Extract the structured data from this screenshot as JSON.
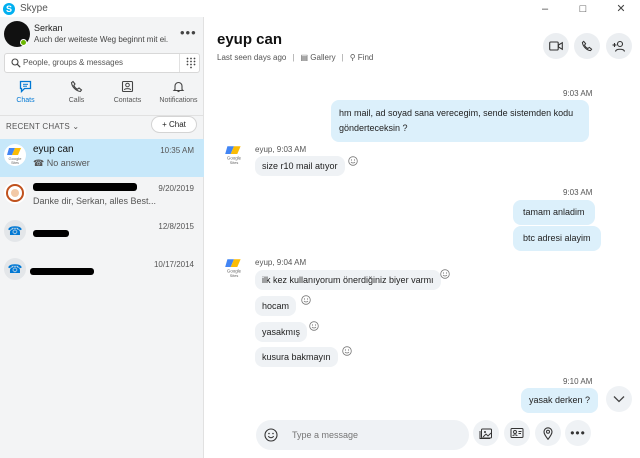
{
  "window": {
    "title": "Skype",
    "controls": [
      "minimize",
      "maximize",
      "close"
    ]
  },
  "profile": {
    "name": "Serkan",
    "mood": "Auch der weiteste Weg beginnt mit ei...",
    "status": "online"
  },
  "search": {
    "placeholder": "People, groups & messages"
  },
  "nav": [
    {
      "label": "Chats",
      "icon": "chat-icon",
      "active": true
    },
    {
      "label": "Calls",
      "icon": "phone-icon",
      "active": false
    },
    {
      "label": "Contacts",
      "icon": "contacts-icon",
      "active": false
    },
    {
      "label": "Notifications",
      "icon": "bell-icon",
      "active": false
    }
  ],
  "recent": {
    "label": "RECENT CHATS",
    "new_chat_label": "+ Chat"
  },
  "contacts": [
    {
      "name": "eyup can",
      "sub": "No answer",
      "date": "10:35 AM",
      "active": true,
      "avatar": "google-sites-logo"
    },
    {
      "name": "",
      "sub": "Danke dir, Serkan, alles Best...",
      "date": "9/20/2019",
      "active": false,
      "avatar": "ring-avatar"
    },
    {
      "name": "",
      "sub": "",
      "date": "12/8/2015",
      "active": false,
      "avatar": "phone-avatar"
    },
    {
      "name": "",
      "sub": "",
      "date": "10/17/2014",
      "active": false,
      "avatar": "phone-avatar"
    }
  ],
  "chat": {
    "title": "eyup can",
    "last_seen": "Last seen days ago",
    "gallery_label": "Gallery",
    "find_label": "Find",
    "header_actions": [
      "video-call",
      "audio-call",
      "add-people"
    ]
  },
  "messages": {
    "ts1": "9:03 AM",
    "out1": "hm mail, ad soyad sana verecegim, sende sistemden kodu gönderteceksin ?",
    "in1_meta": "eyup, 9:03 AM",
    "in1": "size r10 mail atıyor",
    "ts2": "9:03 AM",
    "out2": "tamam anladim",
    "out3": "btc adresi alayim",
    "in2_meta": "eyup, 9:04 AM",
    "in2": "ilk kez kullanıyorum önerdiğiniz biyer varmı",
    "in3": "hocam",
    "in4": "yasakmış",
    "in5": "kusura bakmayın",
    "ts3": "9:10 AM",
    "out4": "yasak derken ?"
  },
  "composer": {
    "placeholder": "Type a message"
  },
  "colors": {
    "accent": "#0078d4",
    "active_contact": "#c7e8fa",
    "outgoing_bubble": "#dcf0fb",
    "incoming_bubble": "#eff2f5"
  }
}
